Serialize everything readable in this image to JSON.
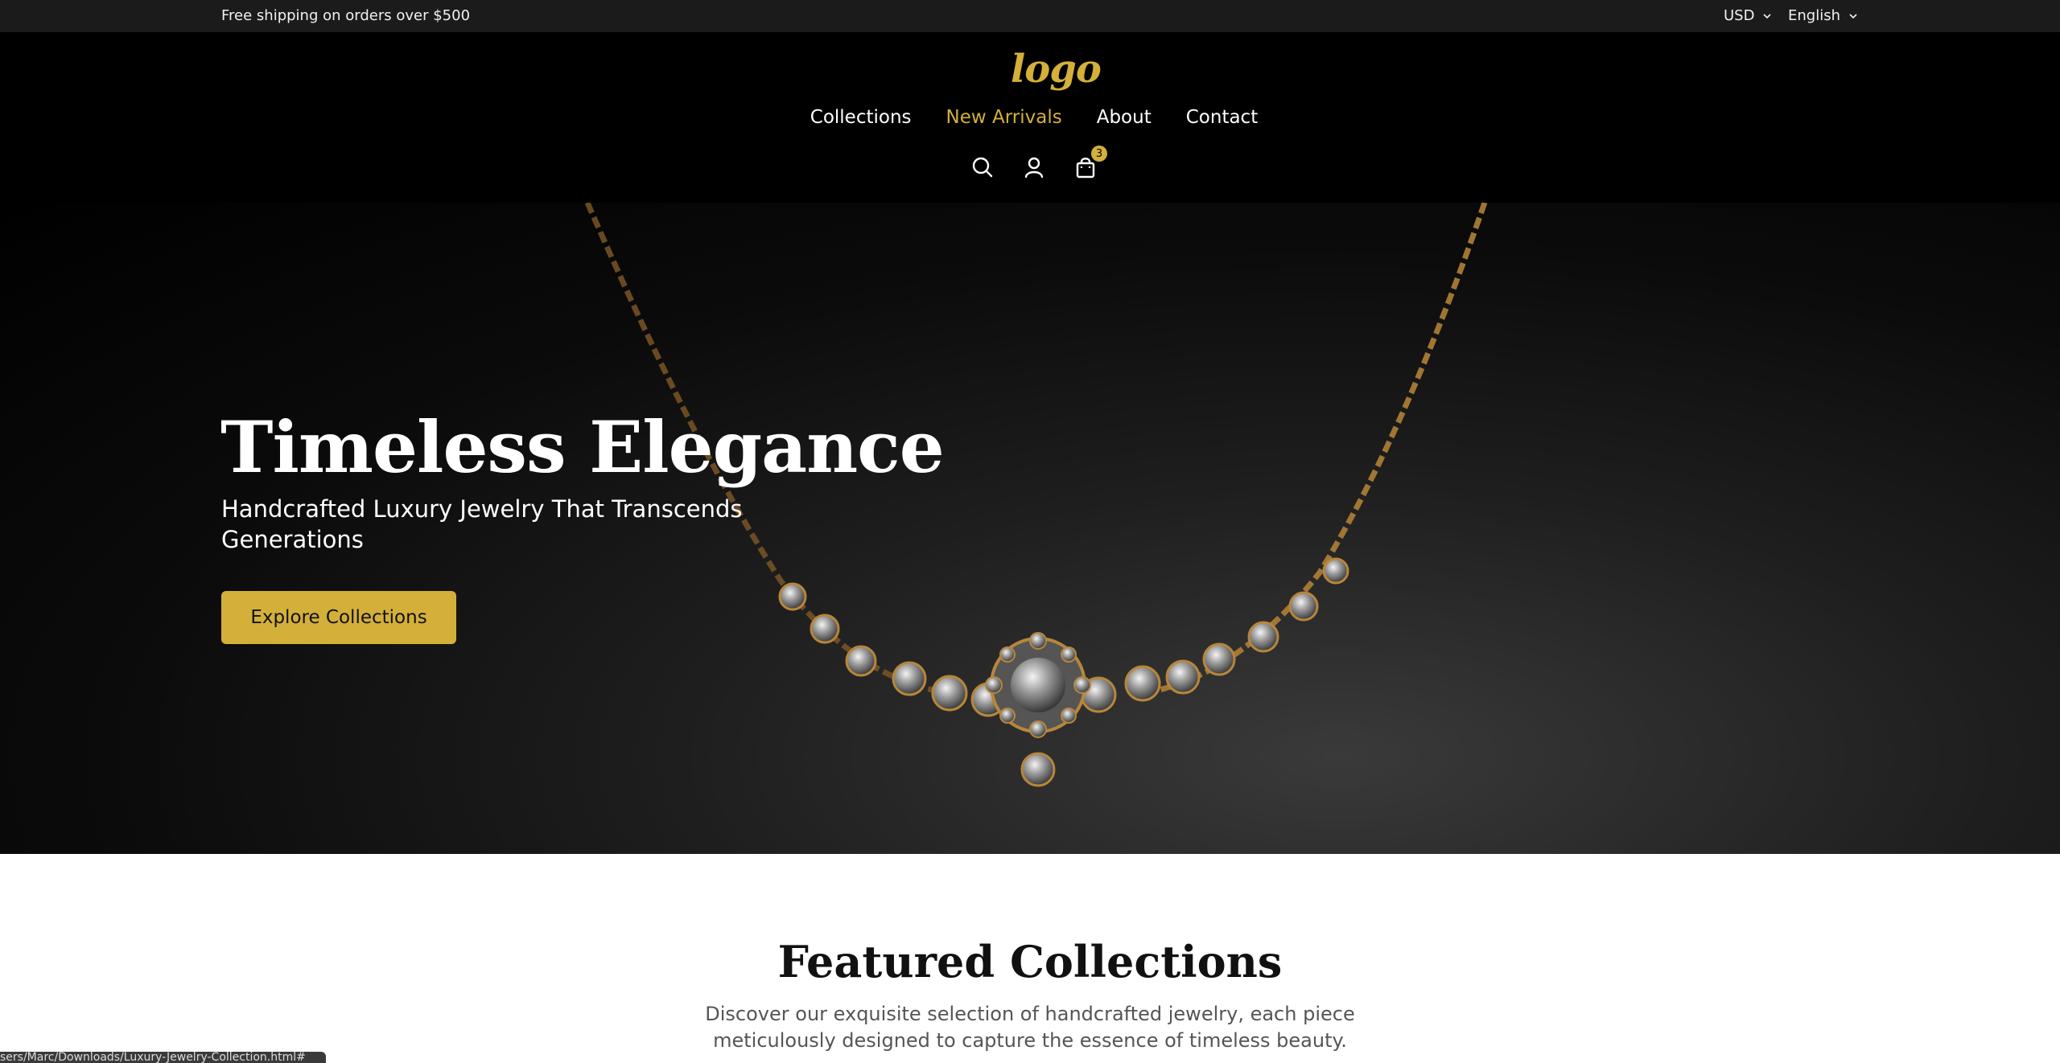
{
  "topbar": {
    "shipping_text": "Free shipping on orders over $500",
    "currency": "USD",
    "language": "English"
  },
  "header": {
    "logo_text": "logo",
    "nav": [
      {
        "label": "Collections",
        "active": false
      },
      {
        "label": "New Arrivals",
        "active": true
      },
      {
        "label": "About",
        "active": false
      },
      {
        "label": "Contact",
        "active": false
      }
    ],
    "icons": [
      "search-icon",
      "user-icon",
      "shopping-bag-icon"
    ],
    "cart_count": "3"
  },
  "hero": {
    "title": "Timeless Elegance",
    "subtitle": "Handcrafted Luxury Jewelry That Transcends Generations",
    "cta_label": "Explore Collections"
  },
  "featured": {
    "title": "Featured Collections",
    "description": "Discover our exquisite selection of handcrafted jewelry, each piece meticulously designed to capture the essence of timeless beauty."
  },
  "status_bar": {
    "url": "sers/Marc/Downloads/Luxury-Jewelry-Collection.html#"
  },
  "colors": {
    "accent": "#d4b03a",
    "topbar_bg": "#1b1b1b",
    "header_bg": "#000000"
  }
}
